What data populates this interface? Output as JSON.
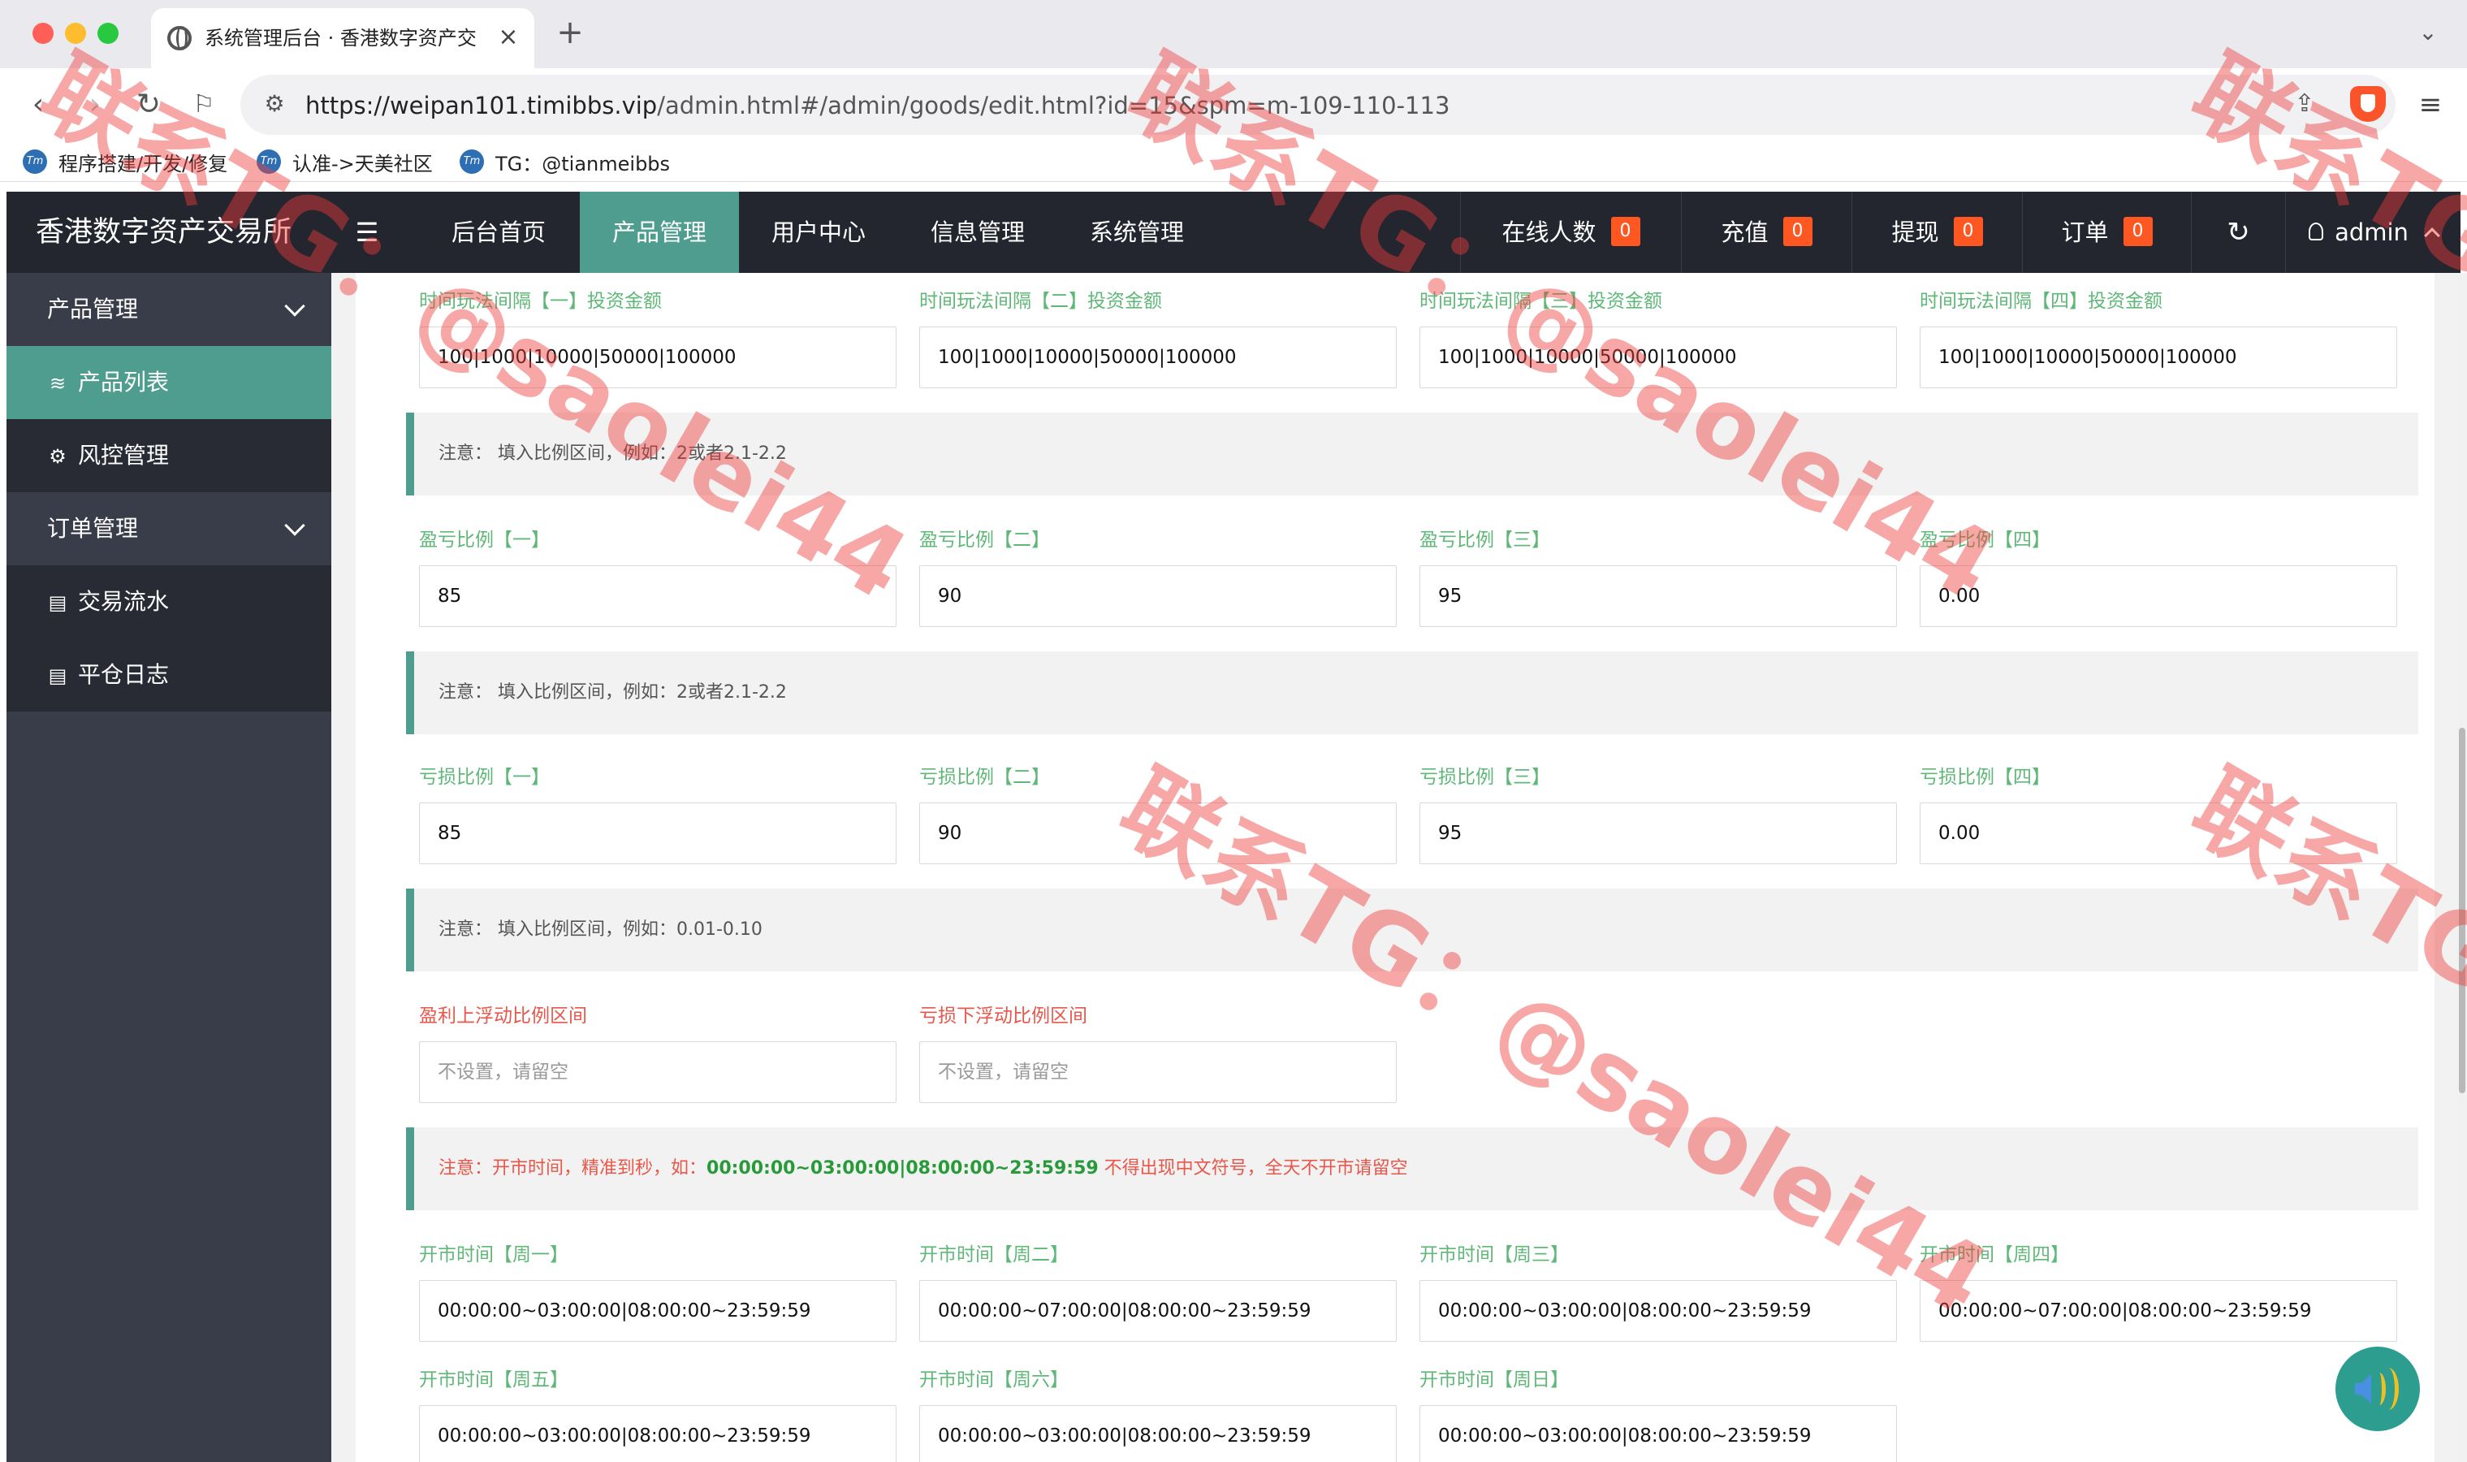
{
  "browser": {
    "tab_title": "系统管理后台 · 香港数字资产交",
    "tab_close": "×",
    "tab_new": "+",
    "url_host": "https://weipan101.timibbs.vip",
    "url_path": "/admin.html#/admin/goods/edit.html?id=15&spm=m-109-110-113",
    "bookmarks": [
      {
        "label": "程序搭建/开发/修复",
        "icon": "tm"
      },
      {
        "label": "认准->天美社区",
        "icon": "tm"
      },
      {
        "label": "TG：@tianmeibbs",
        "icon": "tm"
      }
    ]
  },
  "app": {
    "brand": "香港数字资产交易所",
    "topnav": [
      "后台首页",
      "产品管理",
      "用户中心",
      "信息管理",
      "系统管理"
    ],
    "active_topnav": "产品管理",
    "stats": [
      {
        "label": "在线人数",
        "count": "0"
      },
      {
        "label": "充值",
        "count": "0"
      },
      {
        "label": "提现",
        "count": "0"
      },
      {
        "label": "订单",
        "count": "0"
      }
    ],
    "user": "admin",
    "accent": "#4e9d8f",
    "badge_color": "#ff5722"
  },
  "sidebar": {
    "groups": [
      {
        "label": "产品管理",
        "icon": "chevron-down"
      },
      {
        "label": "产品列表",
        "icon": "layers"
      },
      {
        "label": "风控管理",
        "icon": "gear"
      },
      {
        "label": "订单管理",
        "icon": "chevron-down"
      },
      {
        "label": "交易流水",
        "icon": "clipboard"
      },
      {
        "label": "平仓日志",
        "icon": "clipboard"
      }
    ]
  },
  "form": {
    "invest_labels": [
      "时间玩法间隔【一】投资金额",
      "时间玩法间隔【二】投资金额",
      "时间玩法间隔【三】投资金额",
      "时间玩法间隔【四】投资金额"
    ],
    "invest_values": [
      "100|1000|10000|50000|100000",
      "100|1000|10000|50000|100000",
      "100|1000|10000|50000|100000",
      "100|1000|10000|50000|100000"
    ],
    "note1": "注意：  填入比例区间，例如：2或者2.1-2.2",
    "profit_labels": [
      "盈亏比例【一】",
      "盈亏比例【二】",
      "盈亏比例【三】",
      "盈亏比例【四】"
    ],
    "profit_values": [
      "85",
      "90",
      "95",
      "0.00"
    ],
    "note2": "注意：  填入比例区间，例如：2或者2.1-2.2",
    "loss_labels": [
      "亏损比例【一】",
      "亏损比例【二】",
      "亏损比例【三】",
      "亏损比例【四】"
    ],
    "loss_values": [
      "85",
      "90",
      "95",
      "0.00"
    ],
    "note3": "注意：  填入比例区间，例如：0.01-0.10",
    "float_labels": [
      "盈利上浮动比例区间",
      "亏损下浮动比例区间"
    ],
    "float_placeholders": [
      "不设置，请留空",
      "不设置，请留空"
    ],
    "note4_prefix": "注意：开市时间，精准到秒，如：",
    "note4_example": "00:00:00~03:00:00|08:00:00~23:59:59",
    "note4_suffix": " 不得出现中文符号，全天不开市请留空",
    "open_labels": [
      "开市时间【周一】",
      "开市时间【周二】",
      "开市时间【周三】",
      "开市时间【周四】",
      "开市时间【周五】",
      "开市时间【周六】",
      "开市时间【周日】"
    ],
    "open_values": [
      "00:00:00~03:00:00|08:00:00~23:59:59",
      "00:00:00~07:00:00|08:00:00~23:59:59",
      "00:00:00~03:00:00|08:00:00~23:59:59",
      "00:00:00~07:00:00|08:00:00~23:59:59",
      "00:00:00~03:00:00|08:00:00~23:59:59",
      "00:00:00~03:00:00|08:00:00~23:59:59",
      "00:00:00~03:00:00|08:00:00~23:59:59"
    ]
  },
  "watermark": [
    "联系TG：@saolei44",
    "联系TG：@saolei44",
    "联系TG：@saolei44",
    "联系TG",
    "联系TG"
  ]
}
